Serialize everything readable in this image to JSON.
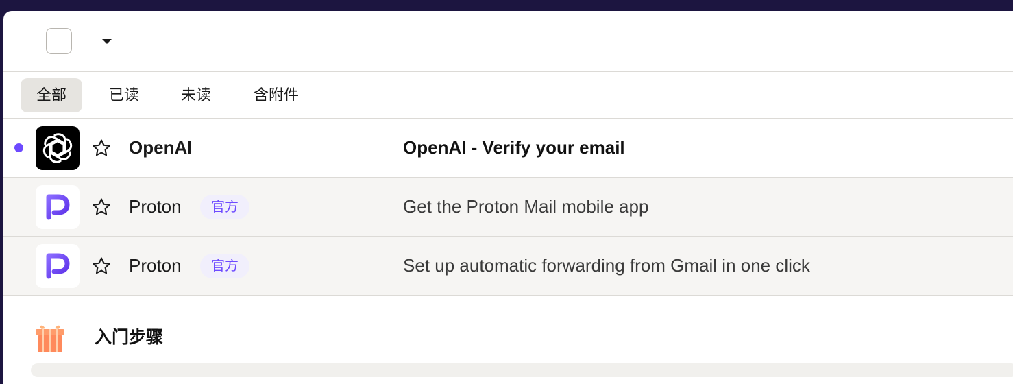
{
  "filters": {
    "all": "全部",
    "read": "已读",
    "unread": "未读",
    "attachments": "含附件"
  },
  "messages": [
    {
      "sender": "OpenAI",
      "subject": "OpenAI - Verify your email",
      "unread": true,
      "avatar_icon": "openai-logo-icon"
    },
    {
      "sender": "Proton",
      "badge": "官方",
      "subject": "Get the Proton Mail mobile app",
      "unread": false,
      "avatar_icon": "proton-logo-icon"
    },
    {
      "sender": "Proton",
      "badge": "官方",
      "subject": "Set up automatic forwarding from Gmail in one click",
      "unread": false,
      "avatar_icon": "proton-logo-icon"
    }
  ],
  "getting_started": {
    "title": "入门步骤",
    "icon": "gift-icon"
  },
  "colors": {
    "accent": "#6d4aff",
    "window_bg": "#1c1540",
    "active_filter_bg": "#e6e4e0",
    "read_row_bg": "#f6f5f3"
  }
}
